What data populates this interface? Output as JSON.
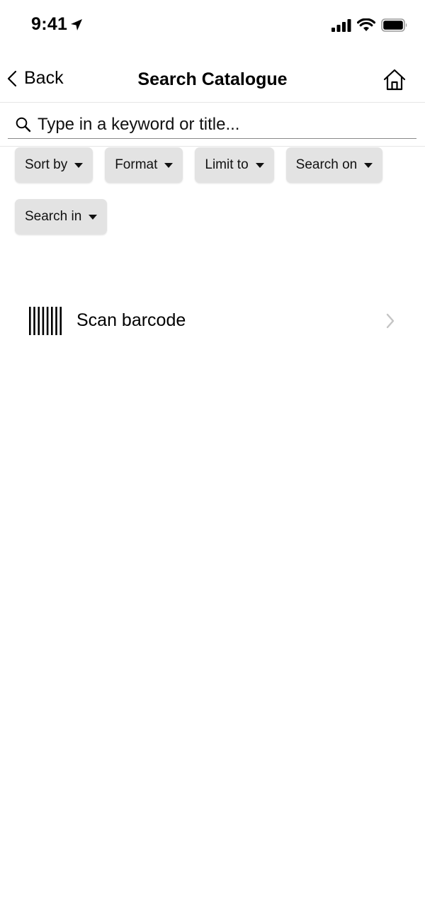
{
  "status_bar": {
    "time": "9:41",
    "icons": [
      "location-arrow-icon",
      "cellular-signal-icon",
      "wifi-icon",
      "battery-icon"
    ]
  },
  "nav": {
    "back_label": "Back",
    "title": "Search Catalogue",
    "back_icon": "chevron-left-icon",
    "home_icon": "home-icon"
  },
  "search": {
    "placeholder": "Type in a keyword or title...",
    "value": "",
    "icon": "search-icon"
  },
  "filters": [
    {
      "label": "Sort by"
    },
    {
      "label": "Format"
    },
    {
      "label": "Limit to"
    },
    {
      "label": "Search on"
    },
    {
      "label": "Search in"
    }
  ],
  "scan": {
    "label": "Scan barcode",
    "icon": "barcode-icon",
    "chevron_icon": "chevron-right-icon"
  },
  "colors": {
    "chip_background": "#e3e3e3",
    "divider": "#e6e6e6",
    "chevron": "#c4c4c4",
    "text": "#000000"
  }
}
